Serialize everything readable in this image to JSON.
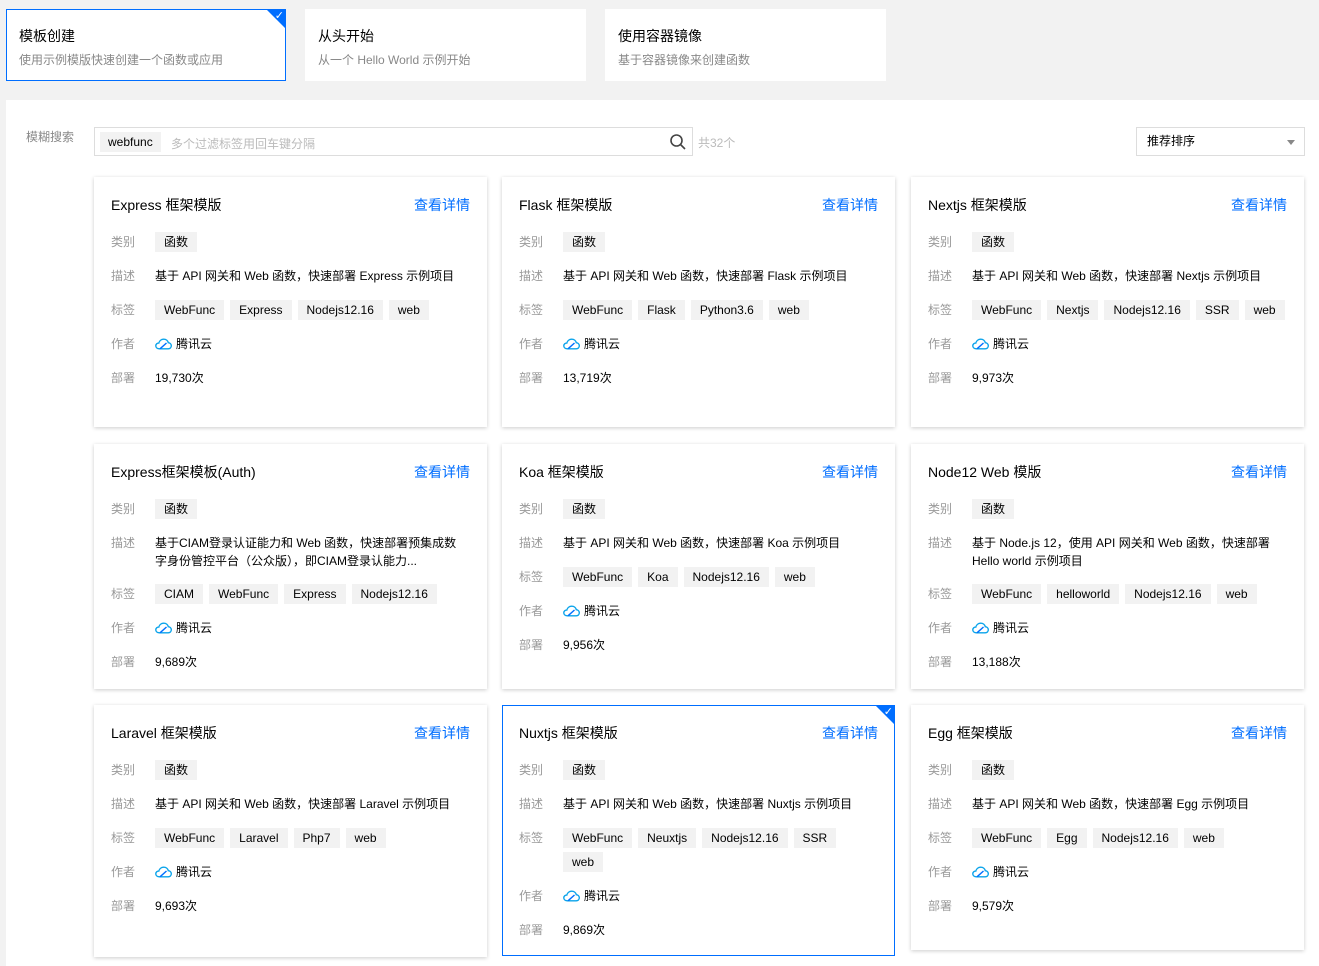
{
  "options": [
    {
      "title": "模板创建",
      "desc": "使用示例模版快速创建一个函数或应用",
      "selected": true
    },
    {
      "title": "从头开始",
      "desc": "从一个 Hello World 示例开始",
      "selected": false
    },
    {
      "title": "使用容器镜像",
      "desc": "基于容器镜像来创建函数",
      "selected": false
    }
  ],
  "search": {
    "label": "模糊搜索",
    "tag": "webfunc",
    "placeholder": "多个过滤标签用回车键分隔",
    "count": "共32个",
    "sort": "推荐排序"
  },
  "labels": {
    "category": "类别",
    "desc": "描述",
    "tags": "标签",
    "author": "作者",
    "deploy": "部署"
  },
  "detail_link": "查看详情",
  "cards": [
    {
      "title": "Express 框架模版",
      "category": "函数",
      "desc": "基于 API 网关和 Web 函数，快速部署 Express 示例项目",
      "tags": [
        "WebFunc",
        "Express",
        "Nodejs12.16",
        "web"
      ],
      "author": "腾讯云",
      "deploy": "19,730次"
    },
    {
      "title": "Flask 框架模版",
      "category": "函数",
      "desc": "基于 API 网关和 Web 函数，快速部署 Flask 示例项目",
      "tags": [
        "WebFunc",
        "Flask",
        "Python3.6",
        "web"
      ],
      "author": "腾讯云",
      "deploy": "13,719次"
    },
    {
      "title": "Nextjs 框架模版",
      "category": "函数",
      "desc": "基于 API 网关和 Web 函数，快速部署 Nextjs 示例项目",
      "tags": [
        "WebFunc",
        "Nextjs",
        "Nodejs12.16",
        "SSR",
        "web"
      ],
      "author": "腾讯云",
      "deploy": "9,973次"
    },
    {
      "title": "Express框架模板(Auth)",
      "category": "函数",
      "desc": "基于CIAM登录认证能力和 Web 函数，快速部署预集成数字身份管控平台（公众版），即CIAM登录认能力...",
      "tags": [
        "CIAM",
        "WebFunc",
        "Express",
        "Nodejs12.16"
      ],
      "author": "腾讯云",
      "deploy": "9,689次"
    },
    {
      "title": "Koa 框架模版",
      "category": "函数",
      "desc": "基于 API 网关和 Web 函数，快速部署 Koa 示例项目",
      "tags": [
        "WebFunc",
        "Koa",
        "Nodejs12.16",
        "web"
      ],
      "author": "腾讯云",
      "deploy": "9,956次"
    },
    {
      "title": "Node12 Web 模版",
      "category": "函数",
      "desc": "基于 Node.js 12，使用 API 网关和 Web 函数，快速部署 Hello world 示例项目",
      "tags": [
        "WebFunc",
        "helloworld",
        "Nodejs12.16",
        "web"
      ],
      "author": "腾讯云",
      "deploy": "13,188次"
    },
    {
      "title": "Laravel 框架模版",
      "category": "函数",
      "desc": "基于 API 网关和 Web 函数，快速部署 Laravel 示例项目",
      "tags": [
        "WebFunc",
        "Laravel",
        "Php7",
        "web"
      ],
      "author": "腾讯云",
      "deploy": "9,693次"
    },
    {
      "title": "Nuxtjs 框架模版",
      "category": "函数",
      "desc": "基于 API 网关和 Web 函数，快速部署 Nuxtjs 示例项目",
      "tags": [
        "WebFunc",
        "Neuxtjs",
        "Nodejs12.16",
        "SSR",
        "web"
      ],
      "author": "腾讯云",
      "deploy": "9,869次",
      "selected": true
    },
    {
      "title": "Egg 框架模版",
      "category": "函数",
      "desc": "基于 API 网关和 Web 函数，快速部署 Egg 示例项目",
      "tags": [
        "WebFunc",
        "Egg",
        "Nodejs12.16",
        "web"
      ],
      "author": "腾讯云",
      "deploy": "9,579次"
    }
  ],
  "colors": {
    "accent": "#006eff",
    "muted": "#999999"
  }
}
